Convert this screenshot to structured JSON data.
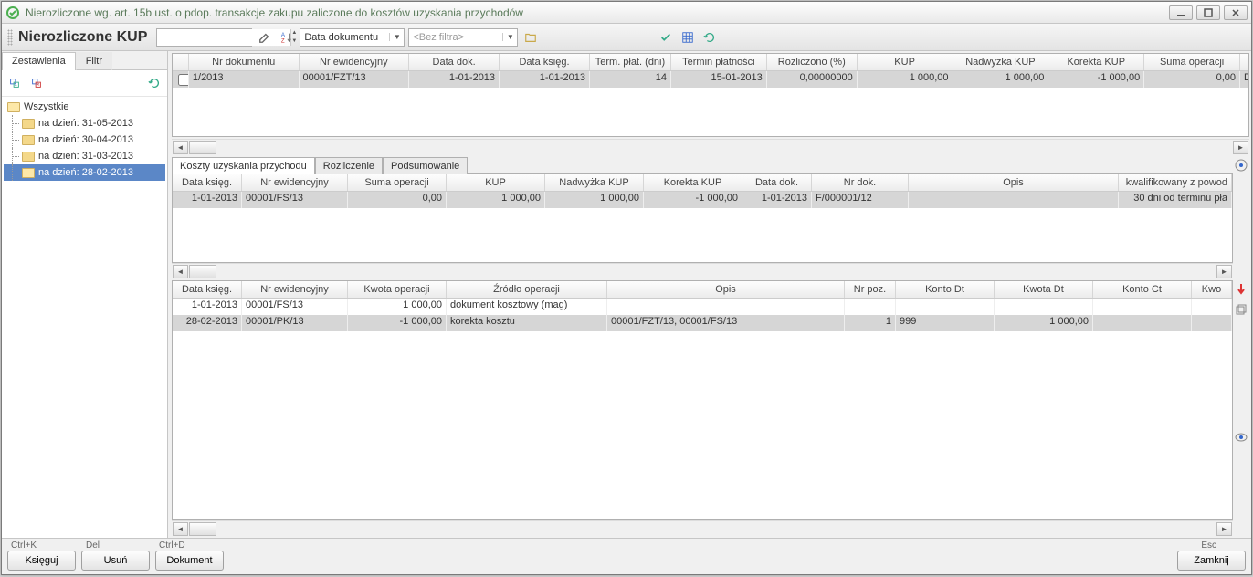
{
  "window": {
    "title": "Nierozliczone wg. art. 15b ust. o pdop. transakcje zakupu zaliczone do kosztów uzyskania przychodów"
  },
  "toolbar": {
    "heading": "Nierozliczone KUP",
    "spin_value": "",
    "date_combo": "Data dokumentu",
    "filter_placeholder": "<Bez filtra>"
  },
  "sidebar": {
    "tabs": [
      "Zestawienia",
      "Filtr"
    ],
    "root": "Wszystkie",
    "items": [
      "na dzień: 31-05-2013",
      "na dzień: 30-04-2013",
      "na dzień: 31-03-2013",
      "na dzień: 28-02-2013"
    ],
    "selected_index": 3
  },
  "grid1": {
    "headers": [
      "",
      "Nr dokumentu",
      "Nr ewidencyjny",
      "Data dok.",
      "Data księg.",
      "Term. płat. (dni)",
      "Termin płatności",
      "Rozliczono (%)",
      "KUP",
      "Nadwyżka KUP",
      "Korekta KUP",
      "Suma operacji",
      ""
    ],
    "row": [
      "",
      "1/2013",
      "00001/FZT/13",
      "1-01-2013",
      "1-01-2013",
      "14",
      "15-01-2013",
      "0,00000000",
      "1 000,00",
      "1 000,00",
      "-1 000,00",
      "0,00",
      "Dostawca"
    ]
  },
  "subtabs": [
    "Koszty uzyskania przychodu",
    "Rozliczenie",
    "Podsumowanie"
  ],
  "grid2": {
    "headers": [
      "Data księg.",
      "Nr ewidencyjny",
      "Suma operacji",
      "KUP",
      "Nadwyżka KUP",
      "Korekta KUP",
      "Data dok.",
      "Nr dok.",
      "Opis",
      "kwalifikowany z powod"
    ],
    "row": [
      "1-01-2013",
      "00001/FS/13",
      "0,00",
      "1 000,00",
      "1 000,00",
      "-1 000,00",
      "1-01-2013",
      "F/000001/12",
      "",
      "30 dni od terminu pła"
    ]
  },
  "grid3": {
    "headers": [
      "Data księg.",
      "Nr ewidencyjny",
      "Kwota operacji",
      "Źródło operacji",
      "Opis",
      "Nr poz.",
      "Konto Dt",
      "Kwota Dt",
      "Konto Ct",
      "Kwo"
    ],
    "rows": [
      [
        "1-01-2013",
        "00001/FS/13",
        "1 000,00",
        "dokument kosztowy (mag)",
        "",
        "",
        "",
        "",
        "",
        ""
      ],
      [
        "28-02-2013",
        "00001/PK/13",
        "-1 000,00",
        "korekta kosztu",
        "00001/FZT/13, 00001/FS/13",
        "1",
        "999",
        "1 000,00",
        "",
        ""
      ]
    ]
  },
  "footer": {
    "shortcuts": [
      "Ctrl+K",
      "Del",
      "Ctrl+D",
      "Esc"
    ],
    "buttons": [
      "Księguj",
      "Usuń",
      "Dokument",
      "Zamknij"
    ]
  }
}
